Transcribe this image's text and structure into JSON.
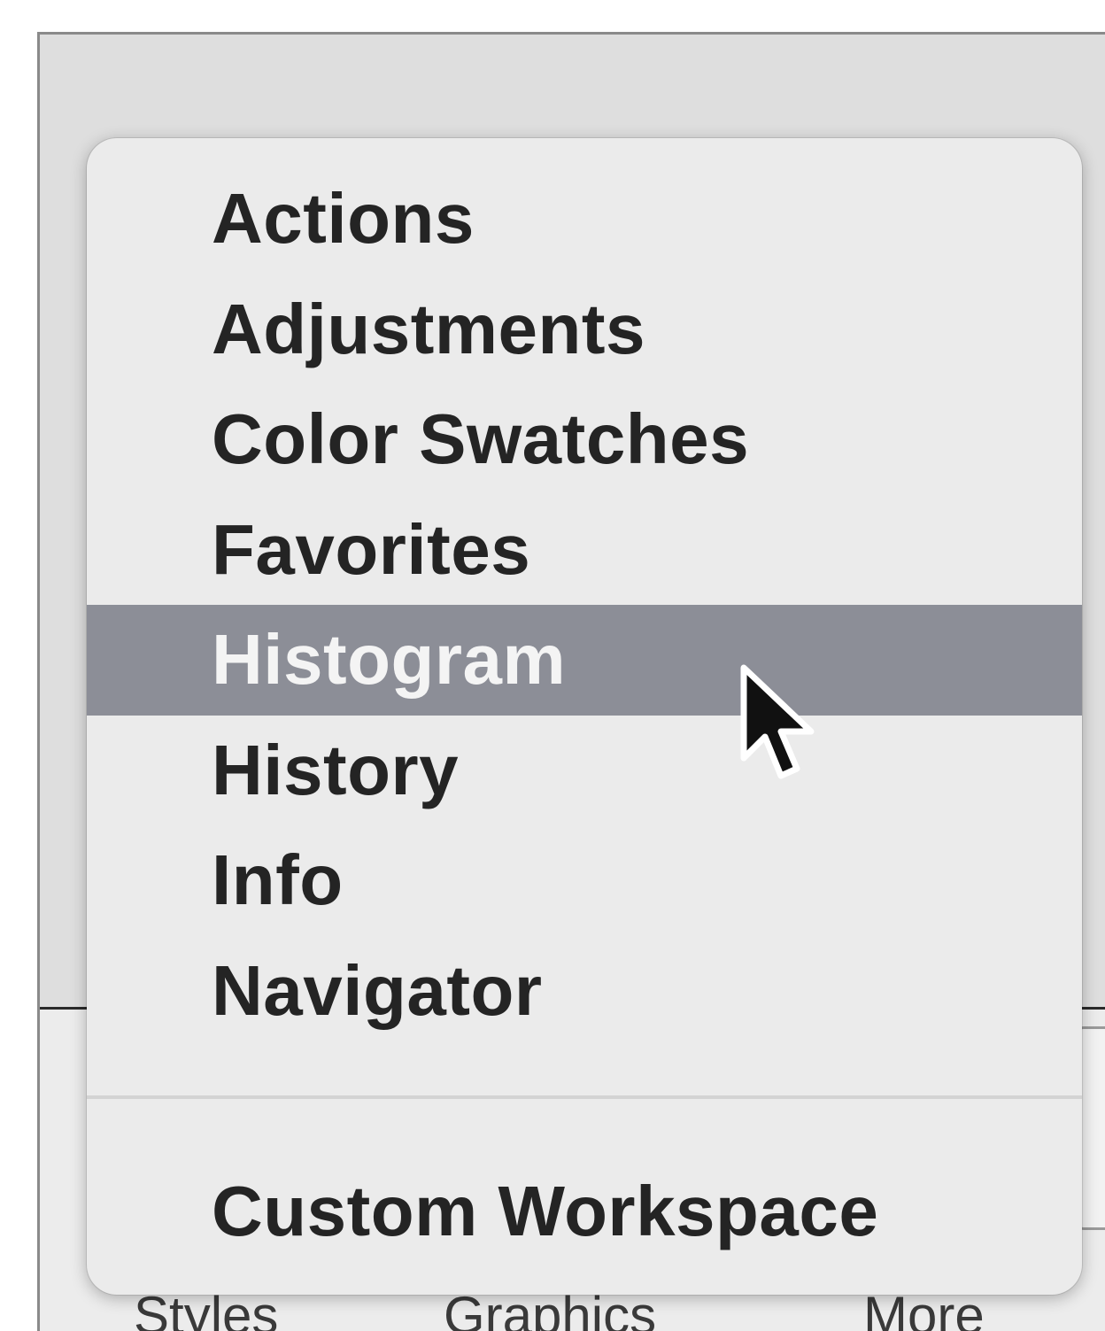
{
  "background_window": {
    "bottom_tabs": [
      "Styles",
      "Graphics",
      "More"
    ]
  },
  "menu": {
    "items": [
      {
        "label": "Actions",
        "highlighted": false
      },
      {
        "label": "Adjustments",
        "highlighted": false
      },
      {
        "label": "Color Swatches",
        "highlighted": false
      },
      {
        "label": "Favorites",
        "highlighted": false
      },
      {
        "label": "Histogram",
        "highlighted": true
      },
      {
        "label": "History",
        "highlighted": false
      },
      {
        "label": "Info",
        "highlighted": false
      },
      {
        "label": "Navigator",
        "highlighted": false
      }
    ],
    "footer_item": {
      "label": "Custom Workspace"
    },
    "highlight_color": "#8c8e97",
    "background_color": "#ebebeb"
  },
  "cursor": {
    "icon": "arrow-pointer-icon"
  }
}
